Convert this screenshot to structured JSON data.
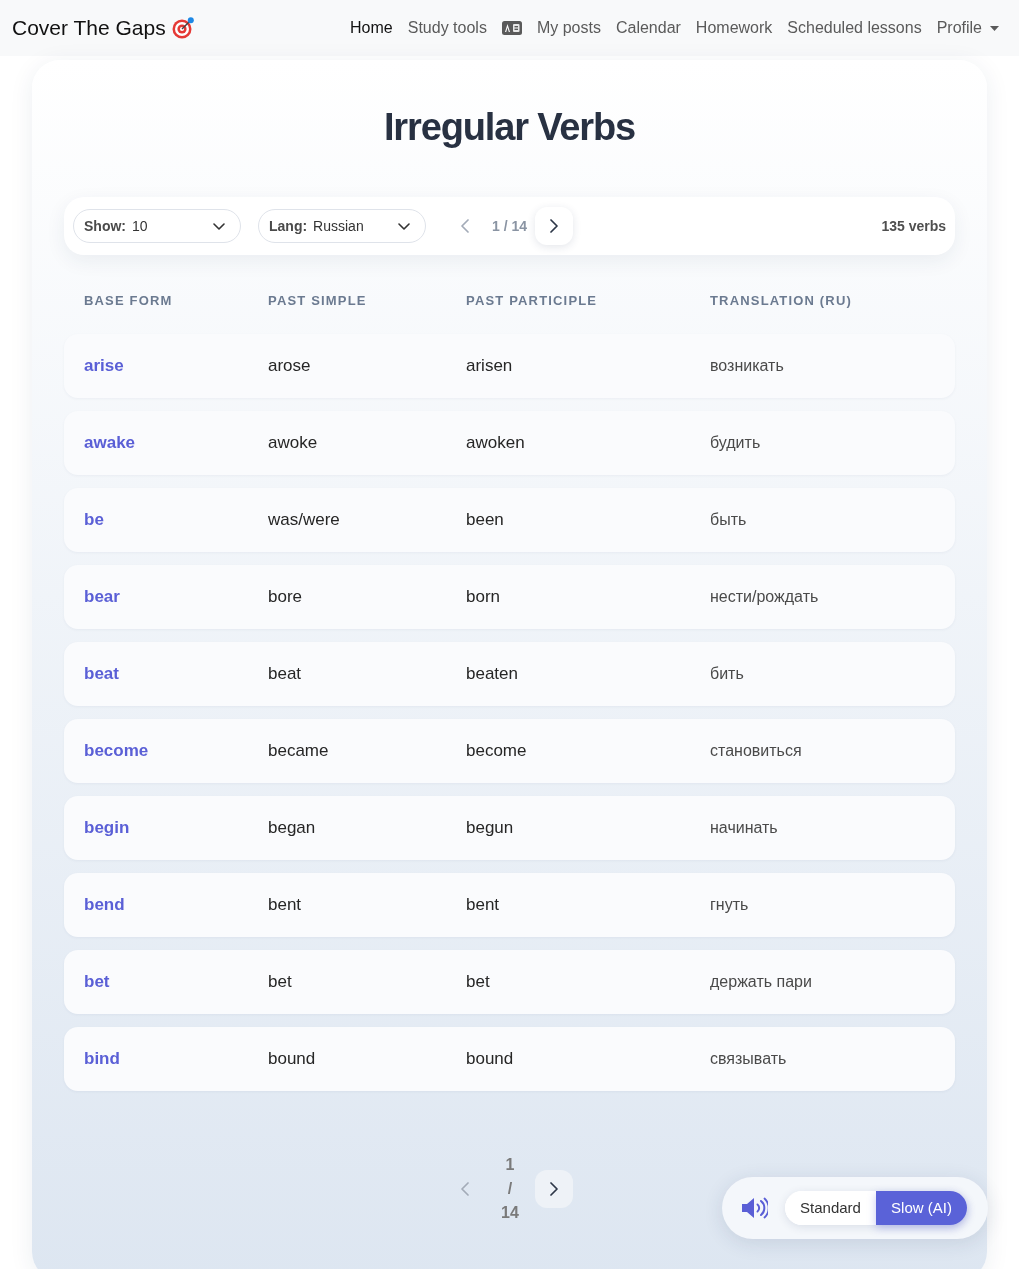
{
  "navbar": {
    "brand": "Cover The Gaps",
    "items": [
      {
        "kind": "link",
        "label": "Home",
        "selected": true
      },
      {
        "kind": "link",
        "label": "Study tools",
        "selected": false
      },
      {
        "kind": "icon",
        "selected": false
      },
      {
        "kind": "link",
        "label": "My posts",
        "selected": false
      },
      {
        "kind": "link",
        "label": "Calendar",
        "selected": false
      },
      {
        "kind": "link",
        "label": "Homework",
        "selected": false
      },
      {
        "kind": "link",
        "label": "Scheduled lessons",
        "selected": false
      },
      {
        "kind": "dropdown",
        "label": "Profile",
        "selected": false
      }
    ]
  },
  "title": "Irregular Verbs",
  "toolbar": {
    "show_select": {
      "label": "Show:",
      "value": "10"
    },
    "lang_select": {
      "label": "Lang:",
      "value": "Russian"
    },
    "pager": {
      "text": "1 / 14",
      "prev": {
        "disabled": true
      },
      "next": {
        "disabled": false
      }
    },
    "count": "135 verbs"
  },
  "table": {
    "columns": [
      "BASE FORM",
      "PAST SIMPLE",
      "PAST PARTICIPLE",
      "TRANSLATION (RU)"
    ],
    "rows": [
      [
        "arise",
        "arose",
        "arisen",
        "возникать"
      ],
      [
        "awake",
        "awoke",
        "awoken",
        "будить"
      ],
      [
        "be",
        "was/were",
        "been",
        "быть"
      ],
      [
        "bear",
        "bore",
        "born",
        "нести/рождать"
      ],
      [
        "beat",
        "beat",
        "beaten",
        "бить"
      ],
      [
        "become",
        "became",
        "become",
        "становиться"
      ],
      [
        "begin",
        "began",
        "begun",
        "начинать"
      ],
      [
        "bend",
        "bent",
        "bent",
        "гнуть"
      ],
      [
        "bet",
        "bet",
        "bet",
        "держать пари"
      ],
      [
        "bind",
        "bound",
        "bound",
        "связывать"
      ]
    ]
  },
  "bottom_pager": {
    "text": "1 / 14",
    "prev": {
      "disabled": true
    },
    "next": {
      "disabled": false
    }
  },
  "audio_speed": {
    "options": [
      {
        "label": "Standard",
        "selected": false
      },
      {
        "label": "Slow (AI)",
        "selected": true
      }
    ]
  }
}
